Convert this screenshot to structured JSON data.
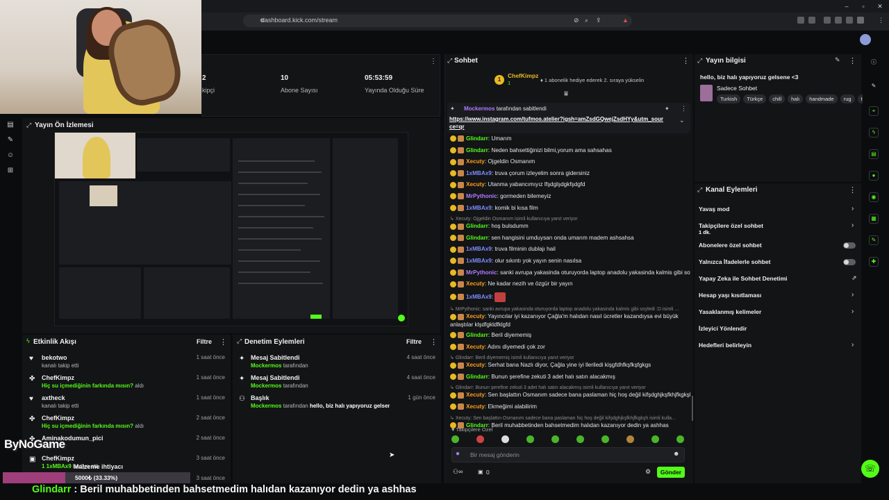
{
  "browser": {
    "url": "dashboard.kick.com/stream"
  },
  "stats": [
    {
      "value": "2",
      "label": "kipçi"
    },
    {
      "value": "10",
      "label": "Abone Sayısı"
    },
    {
      "value": "05:53:59",
      "label": "Yayında Olduğu Süre"
    }
  ],
  "preview": {
    "title": "Yayın Ön İzlemesi"
  },
  "activity": {
    "title": "Etkinlik Akışı",
    "filter": "Filtre",
    "items": [
      {
        "icon": "heart-icon",
        "name": "bekotwo",
        "sub": "kanalı takip etti",
        "time": "1 saat önce"
      },
      {
        "icon": "reward-icon",
        "name": "ChefKimpz",
        "green": "Hiç su içmediğinin farkında mısın?",
        "sub": " aldı",
        "time": "1 saat önce"
      },
      {
        "icon": "heart-icon",
        "name": "axtheck",
        "sub": "kanalı takip etti",
        "time": "1 saat önce"
      },
      {
        "icon": "reward-icon",
        "name": "ChefKimpz",
        "green": "Hiç su içmediğinin farkında mısın?",
        "sub": " aldı",
        "time": "2 saat önce"
      },
      {
        "icon": "reward-icon",
        "name": "Aminakodumun_pici",
        "sub": "",
        "time": "2 saat önce"
      },
      {
        "icon": "gift-icon",
        "name": "ChefKimpz",
        "green": "1 1xMBAx9",
        "sub": " hediye etti.",
        "time": "3 saat önce"
      },
      {
        "icon": "",
        "name": "",
        "sub": "",
        "time": "3 saat önce"
      }
    ]
  },
  "moderation": {
    "title": "Denetim Eylemleri",
    "filter": "Filtre",
    "items": [
      {
        "icon": "pin-icon",
        "name": "Mesaj Sabitlendi",
        "actor": "Mockermos",
        "sub": " tarafından",
        "time": "4 saat önce"
      },
      {
        "icon": "pin-icon",
        "name": "Mesaj Sabitlendi",
        "actor": "Mockermos",
        "sub": " tarafından",
        "time": "4 saat önce"
      },
      {
        "icon": "title-icon",
        "name": "Başlık",
        "actor": "Mockermos",
        "sub": " tarafından ",
        "bold": "hello, biz halı yapıyoruz gelsene <3",
        "sub2": " olarak değiştirildi",
        "time": "1 gün önce"
      }
    ]
  },
  "chat": {
    "title": "Sohbet",
    "top_gifter": {
      "name": "ChefKimpz",
      "count": "1",
      "note": "1 abonelik hediye ederek 2. sıraya yükselin"
    },
    "pinned": {
      "by": "Mockermos",
      "by_suffix": " tarafından sabitlendi",
      "link": "https://www.instagram.com/tufmos.atelier?igsh=amZsdGQwejZsdHYy&utm_source=qr"
    },
    "messages": [
      {
        "type": "msg",
        "user": "Glindarr",
        "color": "#53fc18",
        "text": "Umarım"
      },
      {
        "type": "msg",
        "user": "Glindarr",
        "color": "#53fc18",
        "text": "Neden bahsettiğinizi bilmi,yorum ama sahsahas"
      },
      {
        "type": "msg",
        "user": "Xecuty",
        "color": "#ff9f1a",
        "text": "Ojgeldin Osmanım"
      },
      {
        "type": "msg",
        "user": "1xMBAx9",
        "color": "#7b8cff",
        "text": "truva çorum izleyelim sonra gidersiniz"
      },
      {
        "type": "msg",
        "user": "Xecuty",
        "color": "#ff9f1a",
        "text": "Utanma yabancımıyız lfşdglşdgkfşdgfd"
      },
      {
        "type": "msg",
        "user": "MrPythonic",
        "color": "#b07bff",
        "text": "gormeden bilemeyiz"
      },
      {
        "type": "msg",
        "user": "1xMBAx9",
        "color": "#7b8cff",
        "text": "komik bi kısa film"
      },
      {
        "type": "reply",
        "text": "Xecuty: Ojgeldin Osmanım isimli kullanıcıya yanıt veriyor"
      },
      {
        "type": "msg",
        "user": "Glindarr",
        "color": "#53fc18",
        "text": "hoş bulsdumm"
      },
      {
        "type": "msg",
        "user": "Glindarr",
        "color": "#53fc18",
        "text": "sen hangisini umduysan onda umarım madem ashsahsa"
      },
      {
        "type": "msg",
        "user": "1xMBAx9",
        "color": "#7b8cff",
        "text": "truva filminin dublajı hail"
      },
      {
        "type": "msg",
        "user": "1xMBAx9",
        "color": "#7b8cff",
        "text": "olur sıkıntı yok yayın senin nasılsa"
      },
      {
        "type": "msg",
        "user": "MrPythonic",
        "color": "#b07bff",
        "text": "sanki avrupa yakasinda oturuyorda laptop anadolu yakasinda kalmis gibi soyledi :D"
      },
      {
        "type": "msg",
        "user": "Xecuty",
        "color": "#ff9f1a",
        "text": "Ne kadar nezih ve özgür bir yayın"
      },
      {
        "type": "msg",
        "user": "1xMBAx9",
        "color": "#7b8cff",
        "text": "",
        "emote": true
      },
      {
        "type": "reply",
        "text": "MrPythonic: sanki avrupa yakasinda oturuyorda laptop anadolu yakasinda kalmis gibi soyledi :D isimli ..."
      },
      {
        "type": "msg",
        "user": "Xecuty",
        "color": "#ff9f1a",
        "text": "Yayıncılar iyi kazanıyor Çağla'm halıdan nasıl ücretler kazandıysa evi büyük",
        "cont": "anlaştılar klşdfgkldfklgfd"
      },
      {
        "type": "msg",
        "user": "Glindarr",
        "color": "#53fc18",
        "text": "Beril diyememiş"
      },
      {
        "type": "msg",
        "user": "Xecuty",
        "color": "#ff9f1a",
        "text": "Adını diyemedi çok zor"
      },
      {
        "type": "reply",
        "text": "Glindarr: Beril diyememiş isimli kullanıcıya yanıt veriyor"
      },
      {
        "type": "msg",
        "user": "Xecuty",
        "color": "#ff9f1a",
        "text": "Serhat bana Nazlı diyor, Çağla yine iyi lleriledi kişgfdhfkşfkşfgkgs"
      },
      {
        "type": "msg",
        "user": "Glindarr",
        "color": "#53fc18",
        "text": "Bunun şerefine zekuti 3 adet halı satın alacakmış"
      },
      {
        "type": "reply",
        "text": "Glindarr: Bunun şerefine zekuti 3 adet halı satın alacakmış isimli kullanıcıya yanıt veriyor"
      },
      {
        "type": "msg",
        "user": "Xecuty",
        "color": "#ff9f1a",
        "text": "Sen başlattın Osmanım sadece bana paslaman hiç hoş değil kifşdghjkşfkhjfkgkşh"
      },
      {
        "type": "msg",
        "user": "Xecuty",
        "color": "#ff9f1a",
        "text": "Ekmeğimi alabilirim"
      },
      {
        "type": "reply",
        "text": "Xecuty: Sen başlattın Osmanım sadece bana paslaman hiç hoş değil kifşdghjkşfkhjfkgkşh isimli kulla..."
      },
      {
        "type": "msg",
        "user": "Glindarr",
        "color": "#53fc18",
        "text": "Beril muhabbetinden bahsetmedim halıdan kazanıyor dedin ya ashhas"
      }
    ],
    "followers_only": "Takipçilere Özel",
    "input_placeholder": "Bir mesaj gönderin",
    "count": "0",
    "send_label": "Gönder"
  },
  "stream_info": {
    "title": "Yayın bilgisi",
    "stream_title": "hello, biz halı yapıyoruz gelsene <3",
    "category": "Sadece Sohbet",
    "tags": [
      "Turkish",
      "Türkçe",
      "chill",
      "halı",
      "handmade",
      "rug",
      "t"
    ]
  },
  "channel_actions": {
    "title": "Kanal Eylemleri",
    "items": [
      {
        "label": "Yavaş mod",
        "control": "chevron"
      },
      {
        "label": "Takipçilere özel sohbet",
        "sub": "1 dk.",
        "control": "chevron"
      },
      {
        "label": "Abonelere özel sohbet",
        "control": "toggle"
      },
      {
        "label": "Yalnızca İfadelerle sohbet",
        "control": "toggle"
      },
      {
        "label": "Yapay Zeka ile Sohbet Denetimi",
        "control": "external"
      },
      {
        "label": "Hesap yaşı kısıtlaması",
        "control": "chevron"
      },
      {
        "label": "Yasaklanmış kelimeler",
        "control": "chevron"
      },
      {
        "label": "İzleyici Yönlendir",
        "control": "none"
      },
      {
        "label": "Hedefleri belirleyin",
        "control": "chevron"
      }
    ]
  },
  "overlay": {
    "logo": "ByNoGame",
    "goal_title": "Malzeme ihtiyacı",
    "goal_progress": "5000₺ (33.33%)",
    "goal_fraction": 0.3333,
    "ticker_user": "Glindarr",
    "ticker_text": " : Beril muhabbetinden bahsetmedim halıdan kazanıyor dedin ya ashhas"
  },
  "colors": {
    "accent": "#53fc18",
    "panel": "#131416",
    "bg": "#0b0c0e"
  }
}
